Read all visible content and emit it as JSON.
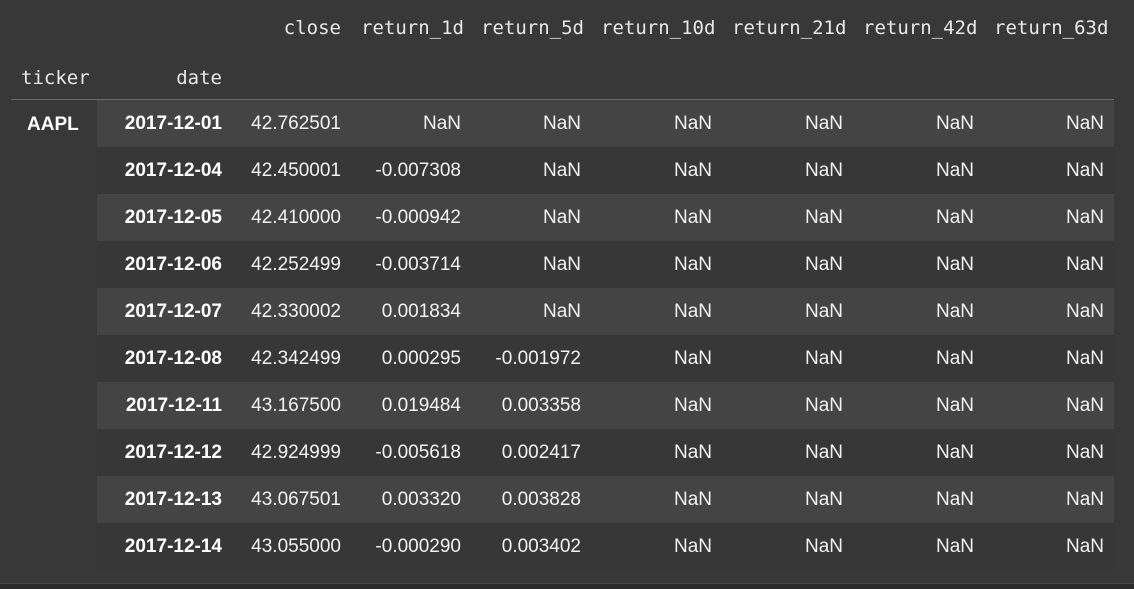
{
  "columns": [
    "close",
    "return_1d",
    "return_5d",
    "return_10d",
    "return_21d",
    "return_42d",
    "return_63d"
  ],
  "index_names": [
    "ticker",
    "date"
  ],
  "ticker": "AAPL",
  "rows": [
    {
      "date": "2017-12-01",
      "values": [
        "42.762501",
        "NaN",
        "NaN",
        "NaN",
        "NaN",
        "NaN",
        "NaN"
      ]
    },
    {
      "date": "2017-12-04",
      "values": [
        "42.450001",
        "-0.007308",
        "NaN",
        "NaN",
        "NaN",
        "NaN",
        "NaN"
      ]
    },
    {
      "date": "2017-12-05",
      "values": [
        "42.410000",
        "-0.000942",
        "NaN",
        "NaN",
        "NaN",
        "NaN",
        "NaN"
      ]
    },
    {
      "date": "2017-12-06",
      "values": [
        "42.252499",
        "-0.003714",
        "NaN",
        "NaN",
        "NaN",
        "NaN",
        "NaN"
      ]
    },
    {
      "date": "2017-12-07",
      "values": [
        "42.330002",
        "0.001834",
        "NaN",
        "NaN",
        "NaN",
        "NaN",
        "NaN"
      ]
    },
    {
      "date": "2017-12-08",
      "values": [
        "42.342499",
        "0.000295",
        "-0.001972",
        "NaN",
        "NaN",
        "NaN",
        "NaN"
      ]
    },
    {
      "date": "2017-12-11",
      "values": [
        "43.167500",
        "0.019484",
        "0.003358",
        "NaN",
        "NaN",
        "NaN",
        "NaN"
      ]
    },
    {
      "date": "2017-12-12",
      "values": [
        "42.924999",
        "-0.005618",
        "0.002417",
        "NaN",
        "NaN",
        "NaN",
        "NaN"
      ]
    },
    {
      "date": "2017-12-13",
      "values": [
        "43.067501",
        "0.003320",
        "0.003828",
        "NaN",
        "NaN",
        "NaN",
        "NaN"
      ]
    },
    {
      "date": "2017-12-14",
      "values": [
        "43.055000",
        "-0.000290",
        "0.003402",
        "NaN",
        "NaN",
        "NaN",
        "NaN"
      ]
    }
  ]
}
